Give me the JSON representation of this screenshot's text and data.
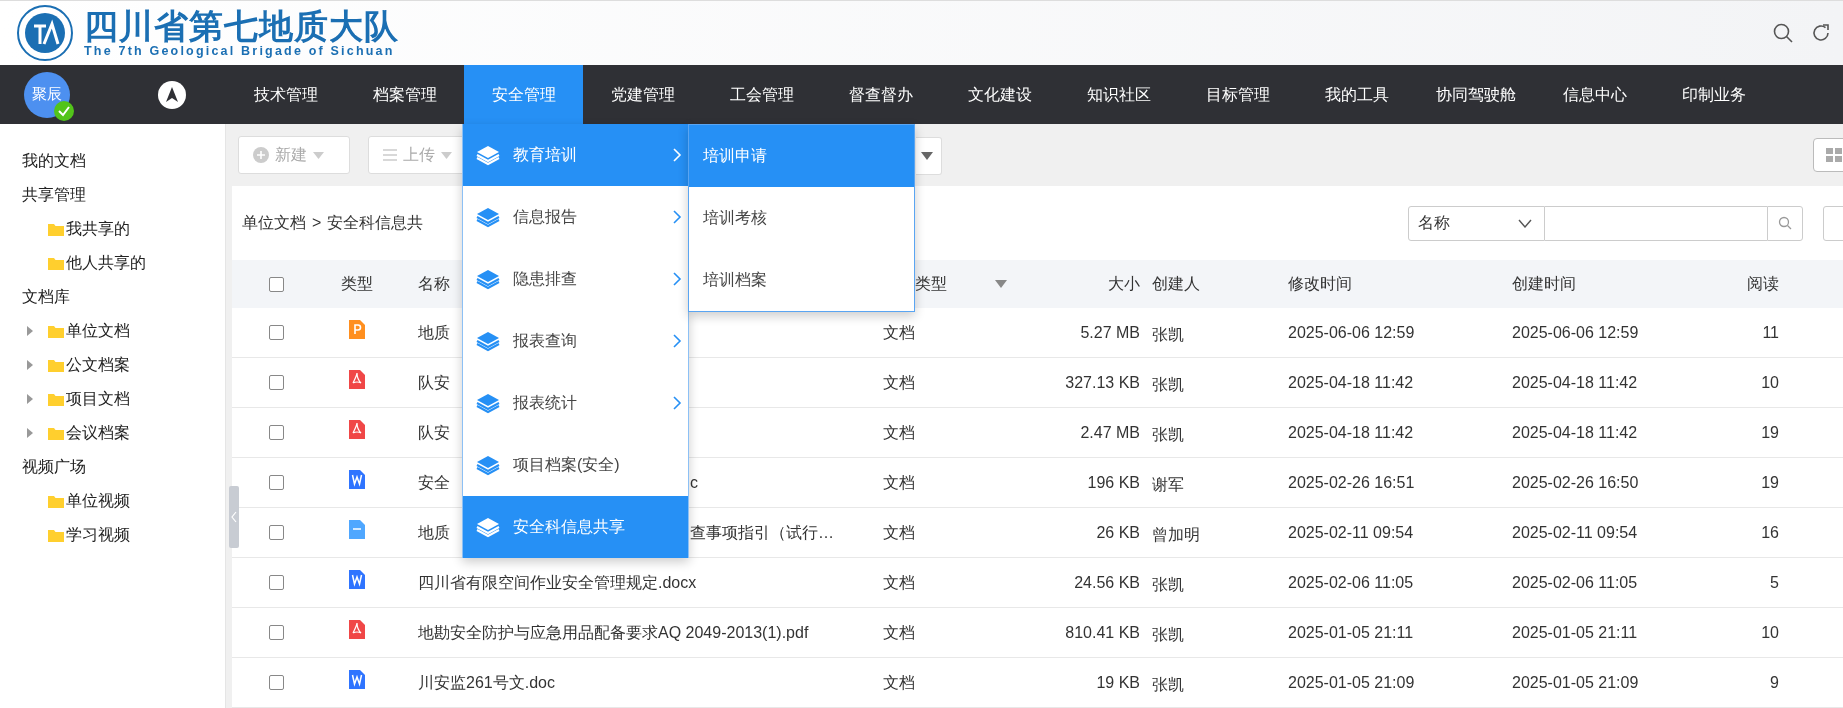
{
  "header": {
    "title": "四川省第七地质大队",
    "subtitle": "The 7th Geological Brigade of Sichuan"
  },
  "nav": {
    "avatar": "聚辰",
    "items": [
      {
        "label": "技术管理",
        "selected": false
      },
      {
        "label": "档案管理",
        "selected": false
      },
      {
        "label": "安全管理",
        "selected": true
      },
      {
        "label": "党建管理",
        "selected": false
      },
      {
        "label": "工会管理",
        "selected": false
      },
      {
        "label": "督查督办",
        "selected": false
      },
      {
        "label": "文化建设",
        "selected": false
      },
      {
        "label": "知识社区",
        "selected": false
      },
      {
        "label": "目标管理",
        "selected": false
      },
      {
        "label": "我的工具",
        "selected": false
      },
      {
        "label": "协同驾驶舱",
        "selected": false
      },
      {
        "label": "信息中心",
        "selected": false
      },
      {
        "label": "印制业务",
        "selected": false
      }
    ]
  },
  "dropdown": {
    "items": [
      {
        "label": "教育培训",
        "selected": true,
        "has_submenu": true
      },
      {
        "label": "信息报告",
        "selected": false,
        "has_submenu": true
      },
      {
        "label": "隐患排查",
        "selected": false,
        "has_submenu": true
      },
      {
        "label": "报表查询",
        "selected": false,
        "has_submenu": true
      },
      {
        "label": "报表统计",
        "selected": false,
        "has_submenu": true
      },
      {
        "label": "项目档案(安全)",
        "selected": false,
        "has_submenu": false
      },
      {
        "label": "安全科信息共享",
        "selected": true,
        "has_submenu": false
      }
    ],
    "submenu": [
      {
        "label": "培训申请",
        "selected": true
      },
      {
        "label": "培训考核",
        "selected": false
      },
      {
        "label": "培训档案",
        "selected": false
      }
    ]
  },
  "sidebar": {
    "items": [
      {
        "label": "我的文档",
        "kind": "section"
      },
      {
        "label": "共享管理",
        "kind": "section",
        "children": [
          {
            "label": "我共享的",
            "kind": "folder"
          },
          {
            "label": "他人共享的",
            "kind": "folder"
          }
        ]
      },
      {
        "label": "文档库",
        "kind": "section",
        "children": [
          {
            "label": "单位文档",
            "kind": "folder",
            "expanded": false
          },
          {
            "label": "公文档案",
            "kind": "folder",
            "expanded": false
          },
          {
            "label": "项目文档",
            "kind": "folder",
            "expanded": false
          },
          {
            "label": "会议档案",
            "kind": "folder",
            "expanded": false
          }
        ]
      },
      {
        "label": "视频广场",
        "kind": "section",
        "children": [
          {
            "label": "单位视频",
            "kind": "folder"
          },
          {
            "label": "学习视频",
            "kind": "folder"
          }
        ]
      }
    ]
  },
  "toolbar": {
    "buttons": [
      "新建",
      "上传"
    ]
  },
  "breadcrumb": {
    "items": [
      "单位文档",
      "安全科信息共"
    ],
    "separator": ">"
  },
  "search": {
    "field": "名称"
  },
  "table": {
    "select_all_checked": false,
    "columns": [
      "类型",
      "名称",
      "类型",
      "大小",
      "创建人",
      "修改时间",
      "创建时间",
      "阅读"
    ],
    "rows": [
      {
        "checked": false,
        "kind": "ppt",
        "name": [
          "地质"
        ],
        "doc_type": "文档",
        "size": "5.27 MB",
        "creator": "张凯",
        "modified": "2025-06-06 12:59",
        "created": "2025-06-06 12:59",
        "reads": "11"
      },
      {
        "checked": false,
        "kind": "pdf",
        "name": [
          "队安"
        ],
        "doc_type": "文档",
        "size": "327.13 KB",
        "creator": "张凯",
        "modified": "2025-04-18 11:42",
        "created": "2025-04-18 11:42",
        "reads": "10"
      },
      {
        "checked": false,
        "kind": "pdf",
        "name": [
          "队安"
        ],
        "doc_type": "文档",
        "size": "2.47 MB",
        "creator": "张凯",
        "modified": "2025-04-18 11:42",
        "created": "2025-04-18 11:42",
        "reads": "19"
      },
      {
        "checked": false,
        "kind": "word",
        "name": [
          "安全",
          "c"
        ],
        "doc_type": "文档",
        "size": "196 KB",
        "creator": "谢军",
        "modified": "2025-02-26 16:51",
        "created": "2025-02-26 16:50",
        "reads": "19"
      },
      {
        "checked": false,
        "kind": "wps",
        "name": [
          "地质",
          "查事项指引（试行…"
        ],
        "doc_type": "文档",
        "size": "26 KB",
        "creator": "曾加明",
        "modified": "2025-02-11 09:54",
        "created": "2025-02-11 09:54",
        "reads": "16"
      },
      {
        "checked": false,
        "kind": "word",
        "name": [
          "四川省有限空间作业安全管理规定.docx"
        ],
        "doc_type": "文档",
        "size": "24.56 KB",
        "creator": "张凯",
        "modified": "2025-02-06 11:05",
        "created": "2025-02-06 11:05",
        "reads": "5"
      },
      {
        "checked": false,
        "kind": "pdf",
        "name": [
          "地勘安全防护与应急用品配备要求AQ 2049-2013(1).pdf"
        ],
        "doc_type": "文档",
        "size": "810.41 KB",
        "creator": "张凯",
        "modified": "2025-01-05 21:11",
        "created": "2025-01-05 21:11",
        "reads": "10"
      },
      {
        "checked": false,
        "kind": "word",
        "name": [
          "川安监261号文.doc"
        ],
        "doc_type": "文档",
        "size": "19 KB",
        "creator": "张凯",
        "modified": "2025-01-05 21:09",
        "created": "2025-01-05 21:09",
        "reads": "9"
      }
    ]
  }
}
